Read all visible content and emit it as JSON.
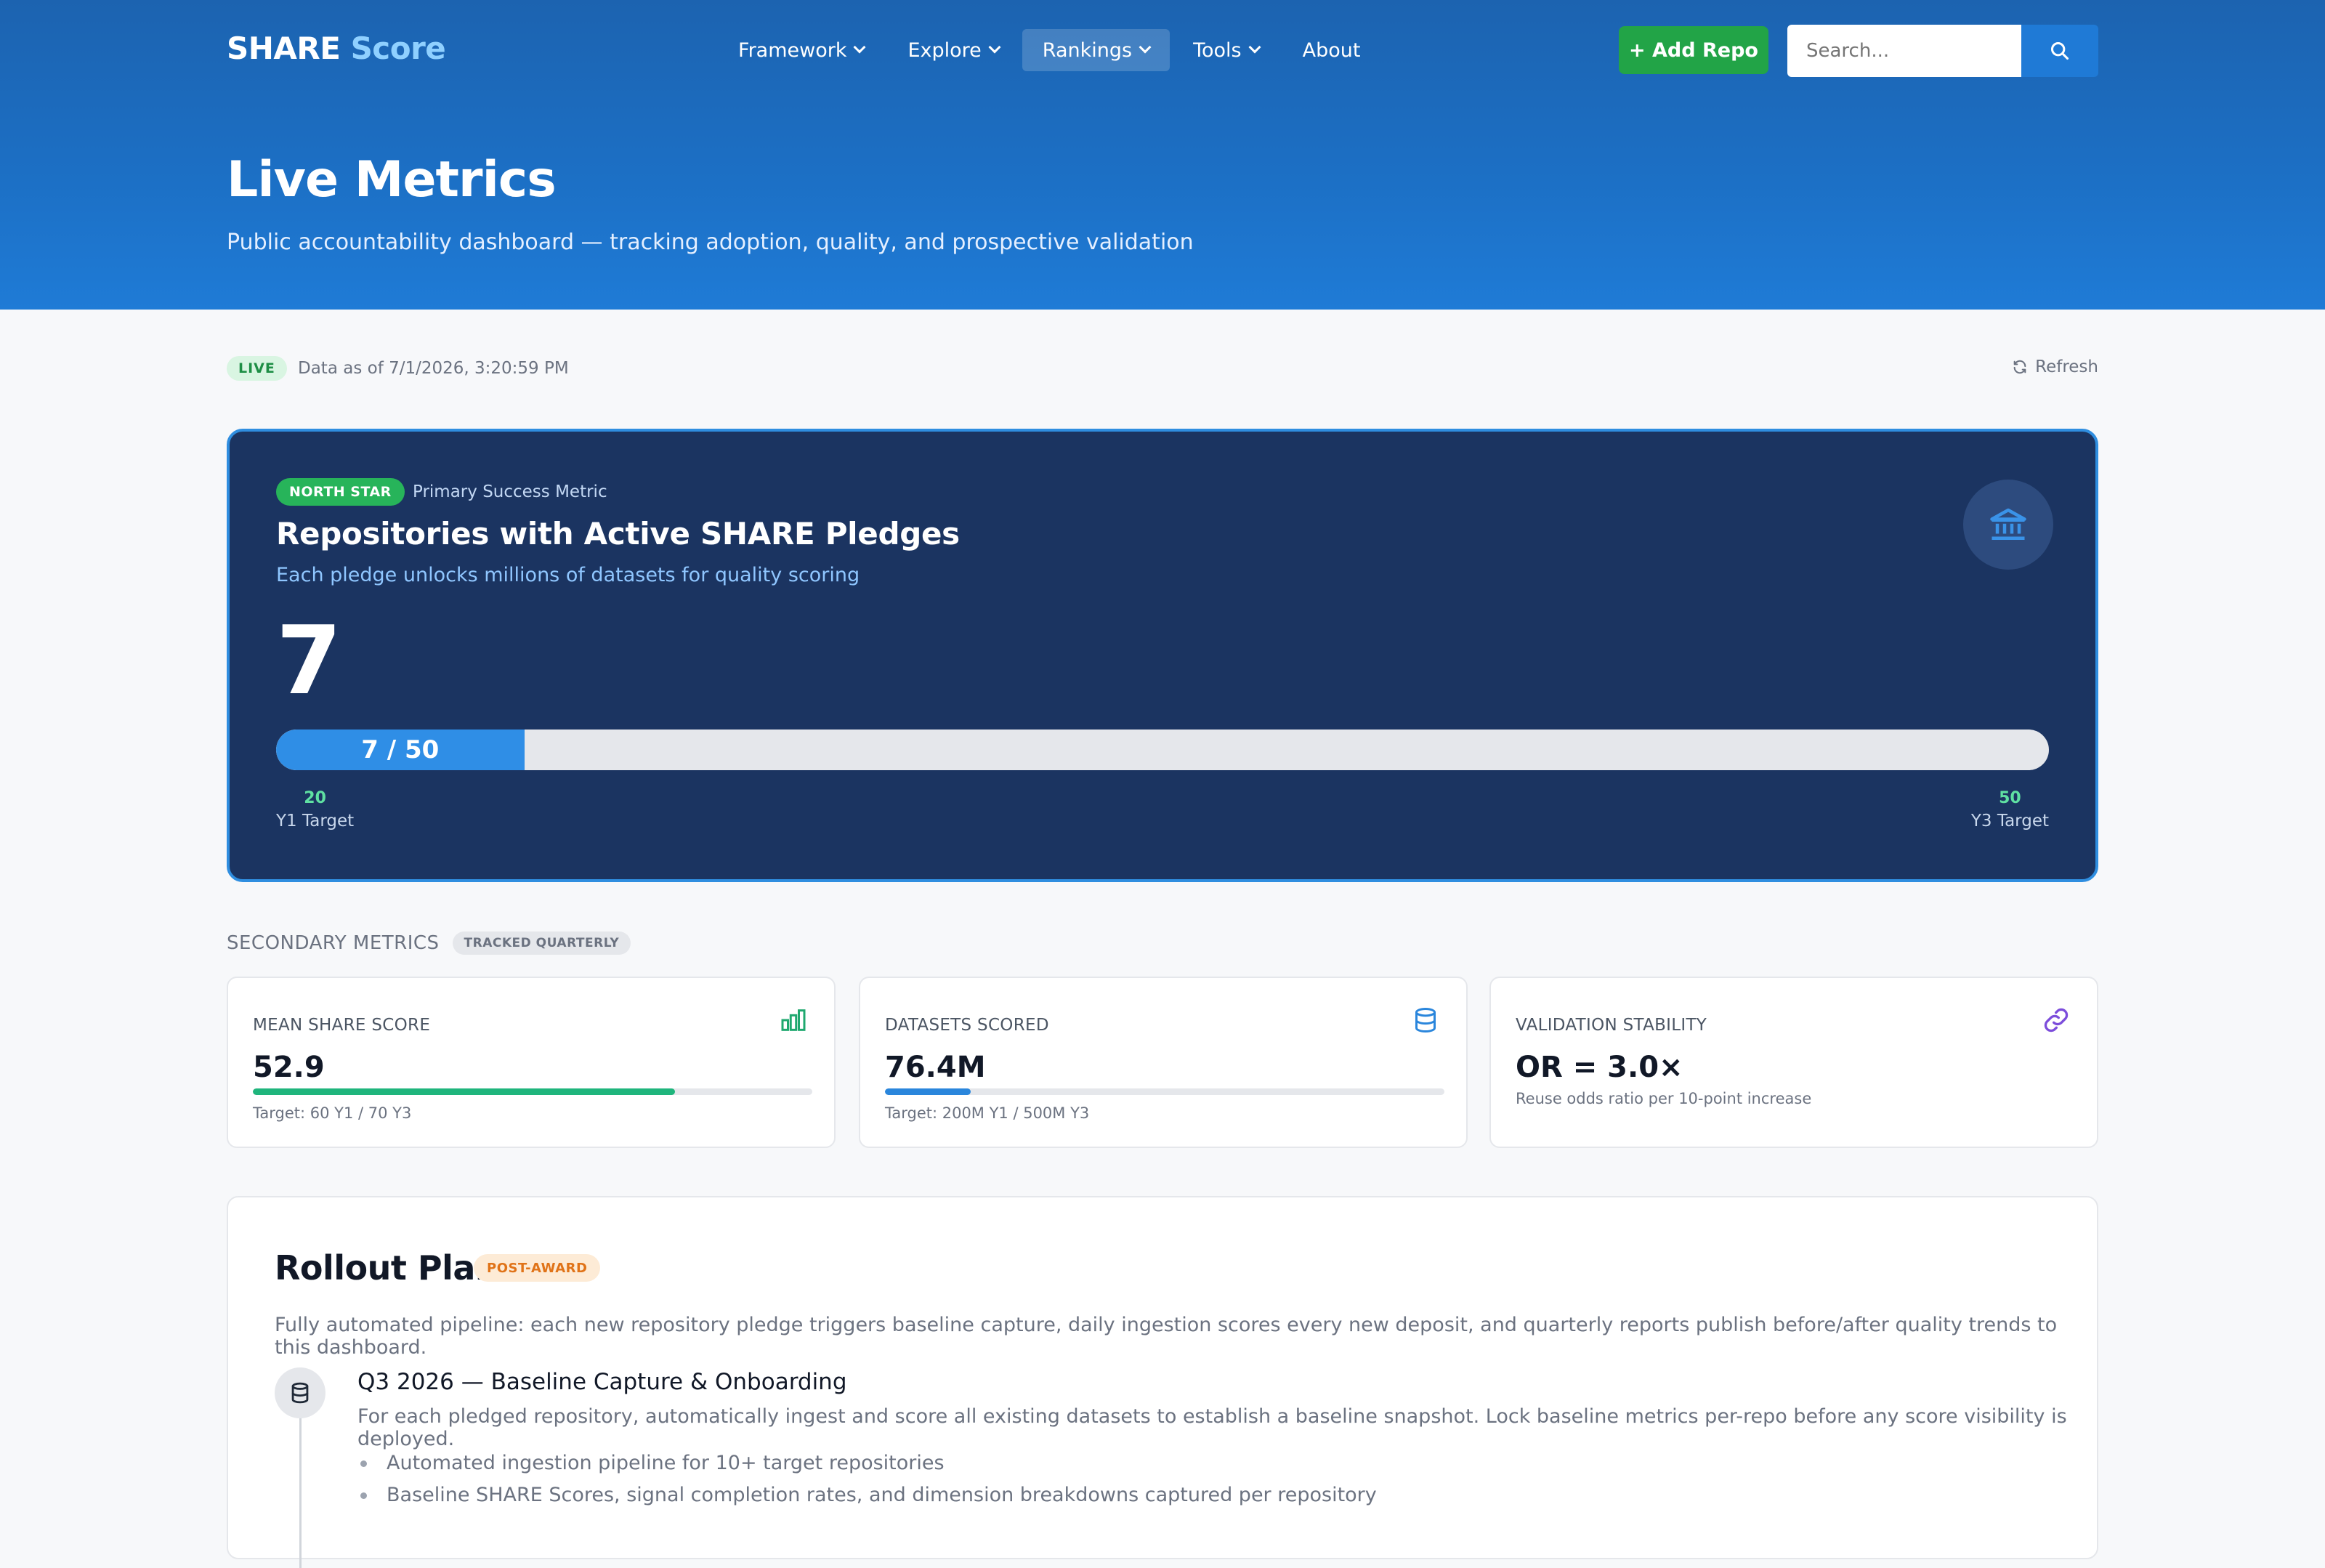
{
  "brand": {
    "name_primary": "SHARE",
    "name_accent": "Score"
  },
  "nav": {
    "items": [
      {
        "label": "Framework",
        "has_dropdown": true
      },
      {
        "label": "Explore",
        "has_dropdown": true
      },
      {
        "label": "Rankings",
        "has_dropdown": true,
        "active": true
      },
      {
        "label": "Tools",
        "has_dropdown": true
      },
      {
        "label": "About",
        "has_dropdown": false
      }
    ],
    "add_repo_label": "+ Add Repo",
    "search_placeholder": "Search..."
  },
  "hero": {
    "title": "Live Metrics",
    "subtitle": "Public accountability dashboard — tracking adoption, quality, and prospective validation"
  },
  "status": {
    "live_badge": "LIVE",
    "as_of": "Data as of 7/1/2026, 3:20:59 PM",
    "refresh_label": "Refresh"
  },
  "north_star": {
    "badge": "NORTH STAR",
    "kicker": "Primary Success Metric",
    "title": "Repositories with Active SHARE Pledges",
    "subtitle": "Each pledge unlocks millions of datasets for quality scoring",
    "value": "7",
    "progress_label": "7 / 50",
    "progress_fraction": 0.14,
    "targets": [
      {
        "value": "20",
        "label": "Y1 Target"
      },
      {
        "value": "50",
        "label": "Y3 Target"
      }
    ],
    "icon": "bank-icon"
  },
  "secondary": {
    "heading": "SECONDARY METRICS",
    "badge": "TRACKED QUARTERLY",
    "cards": [
      {
        "label": "MEAN SHARE SCORE",
        "value": "52.9",
        "note": "Target: 60 Y1 / 70 Y3",
        "progress_fraction": 0.755,
        "bar_color": "#1fb57c",
        "icon": "bar-chart-icon"
      },
      {
        "label": "DATASETS SCORED",
        "value": "76.4M",
        "note": "Target: 200M Y1 / 500M Y3",
        "progress_fraction": 0.153,
        "bar_color": "#2a86dc",
        "icon": "database-icon"
      },
      {
        "label": "VALIDATION STABILITY",
        "value": "OR = 3.0×",
        "note": "Reuse odds ratio per 10-point increase",
        "icon": "link-icon"
      }
    ]
  },
  "rollout": {
    "title": "Rollout Plan",
    "badge": "POST-AWARD",
    "description": "Fully automated pipeline: each new repository pledge triggers baseline capture, daily ingestion scores every new deposit, and quarterly reports publish before/after quality trends to this dashboard.",
    "phases": [
      {
        "title": "Q3 2026 — Baseline Capture & Onboarding",
        "description": "For each pledged repository, automatically ingest and score all existing datasets to establish a baseline snapshot. Lock baseline metrics per-repo before any score visibility is deployed.",
        "bullets": [
          "Automated ingestion pipeline for 10+ target repositories",
          "Baseline SHARE Scores, signal completion rates, and dimension breakdowns captured per repository"
        ],
        "icon": "database-icon"
      }
    ]
  },
  "colors": {
    "header_blue": "#1c6fc4",
    "north_star_bg": "#1b3461",
    "accent_green": "#22a447",
    "accent_blue": "#2f8ee6"
  }
}
